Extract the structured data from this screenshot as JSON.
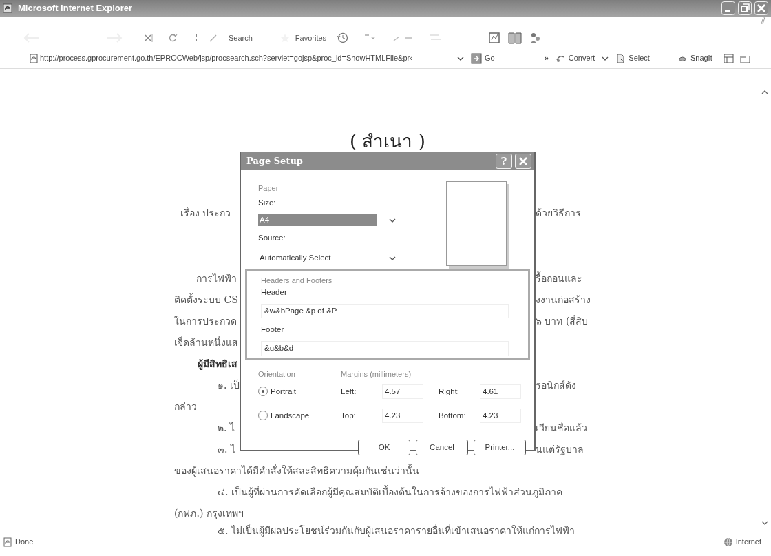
{
  "window": {
    "title": "Microsoft Internet Explorer"
  },
  "toolbar": {
    "buttons": [
      {
        "label": "Search"
      },
      {
        "label": "Favorites"
      }
    ]
  },
  "address_bar": {
    "url": "http://process.gprocurement.go.th/EPROCWeb/jsp/procsearch.sch?servlet=gojsp&proc_id=ShowHTMLFile&pr‹",
    "go": "Go"
  },
  "links_bar": {
    "chevron": "»",
    "items": [
      {
        "label": "Convert",
        "dropdown": true
      },
      {
        "label": "Select",
        "dropdown": false
      },
      {
        "label": "SnagIt",
        "dropdown": false
      }
    ]
  },
  "document": {
    "title": "( สำเนา )",
    "lines": [
      {
        "kind": "subject",
        "left": "เรื่อง ประกว",
        "right": "ด้วยวิธีการ"
      },
      {
        "kind": "para",
        "left": "การไฟฟ้า",
        "right": "รื้อถอนและ"
      },
      {
        "kind": "body",
        "left": "ติดตั้งระบบ CS",
        "right": "งงานก่อสร้าง"
      },
      {
        "kind": "body",
        "left": "ในการประกวด",
        "right": "๖ บาท (สี่สิบ"
      },
      {
        "kind": "body",
        "left": "เจ็ดล้านหนึ่งแส"
      },
      {
        "kind": "heading",
        "left": "ผู้มีสิทธิเส"
      },
      {
        "kind": "item",
        "left": "๑. เป็",
        "right": "รอนิกส์ดัง"
      },
      {
        "kind": "body",
        "left": "กล่าว"
      },
      {
        "kind": "item",
        "left": "๒. ไ",
        "right": "เวียนชื่อแล้ว"
      },
      {
        "kind": "item",
        "left": "๓. ไ",
        "right": "นแต่รัฐบาล"
      },
      {
        "kind": "body",
        "text": "ของผู้เสนอราคาได้มีคำสั่งให้สละสิทธิความคุ้มกันเช่นว่านั้น"
      },
      {
        "kind": "item",
        "text": "๔. เป็นผู้ที่ผ่านการคัดเลือกผู้มีคุณสมบัติเบื้องต้นในการจ้างของการไฟฟ้าส่วนภูมิภาค"
      },
      {
        "kind": "body",
        "text": "(กฟภ.) กรุงเทพฯ"
      },
      {
        "kind": "cut",
        "text": "๕. ไม่เป็นผู้มีผลประโยชน์ร่วมกันกับผู้เสนอราคารายอื่นที่เข้าเสนอราคาให้แก่การไฟฟ้า"
      }
    ]
  },
  "dialog": {
    "title": "Page Setup",
    "help": "?",
    "paper": {
      "label": "Paper",
      "size_label": "Size:",
      "size": "A4",
      "highlighted": true,
      "source_label": "Source:",
      "source": "Automatically Select"
    },
    "headers_footers": {
      "label": "Headers and Footers",
      "header_label": "Header",
      "header": "&w&bPage &p of &P",
      "footer_label": "Footer",
      "footer": "&u&b&d"
    },
    "orientation": {
      "label": "Orientation",
      "options": [
        {
          "label": "Portrait",
          "selected": true
        },
        {
          "label": "Landscape",
          "selected": false
        }
      ]
    },
    "margins": {
      "label": "Margins (millimeters)",
      "fields": [
        {
          "label": "Left:",
          "value": "4.57"
        },
        {
          "label": "Right:",
          "value": "4.61"
        },
        {
          "label": "Top:",
          "value": "4.23"
        },
        {
          "label": "Bottom:",
          "value": "4.23"
        }
      ]
    },
    "buttons": [
      {
        "label": "OK"
      },
      {
        "label": "Cancel"
      },
      {
        "label": "Printer..."
      }
    ]
  },
  "status_bar": {
    "text": "Done",
    "zone": "Internet"
  }
}
